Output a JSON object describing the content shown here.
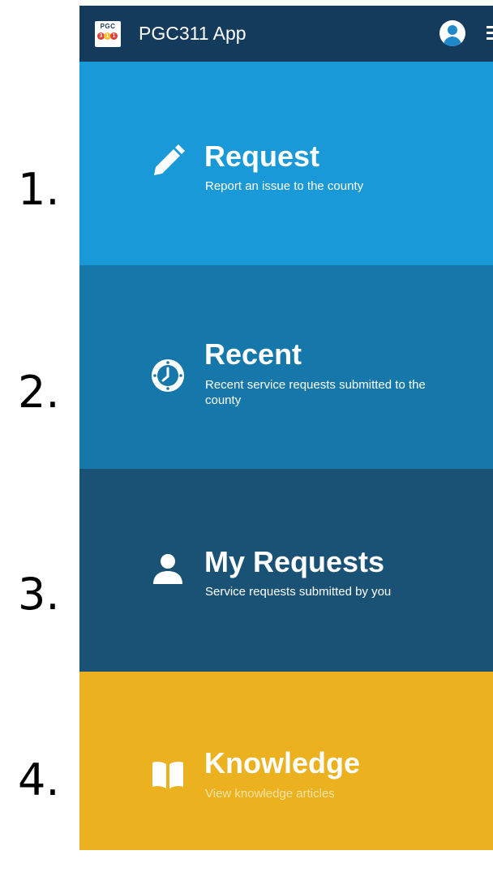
{
  "annotations": [
    "1.",
    "2.",
    "3.",
    "4."
  ],
  "app_bar": {
    "logo_text": "PGC",
    "logo_digits": [
      "3",
      "1",
      "1"
    ],
    "title": "PGC311 App",
    "profile_icon": "account-circle-icon",
    "menu_icon": "menu-icon"
  },
  "tiles": [
    {
      "title": "Request",
      "subtitle": "Report an issue to the county",
      "icon": "pencil-icon",
      "color": "#1a99d8"
    },
    {
      "title": "Recent",
      "subtitle": "Recent service requests submitted to the county",
      "icon": "clock-icon",
      "color": "#1677aa"
    },
    {
      "title": "My Requests",
      "subtitle": "Service requests submitted by you",
      "icon": "person-icon",
      "color": "#1a5276"
    },
    {
      "title": "Knowledge",
      "subtitle": "View knowledge articles",
      "icon": "book-icon",
      "color": "#ebb11f"
    }
  ],
  "colors": {
    "app_bar": "#143b5c"
  }
}
